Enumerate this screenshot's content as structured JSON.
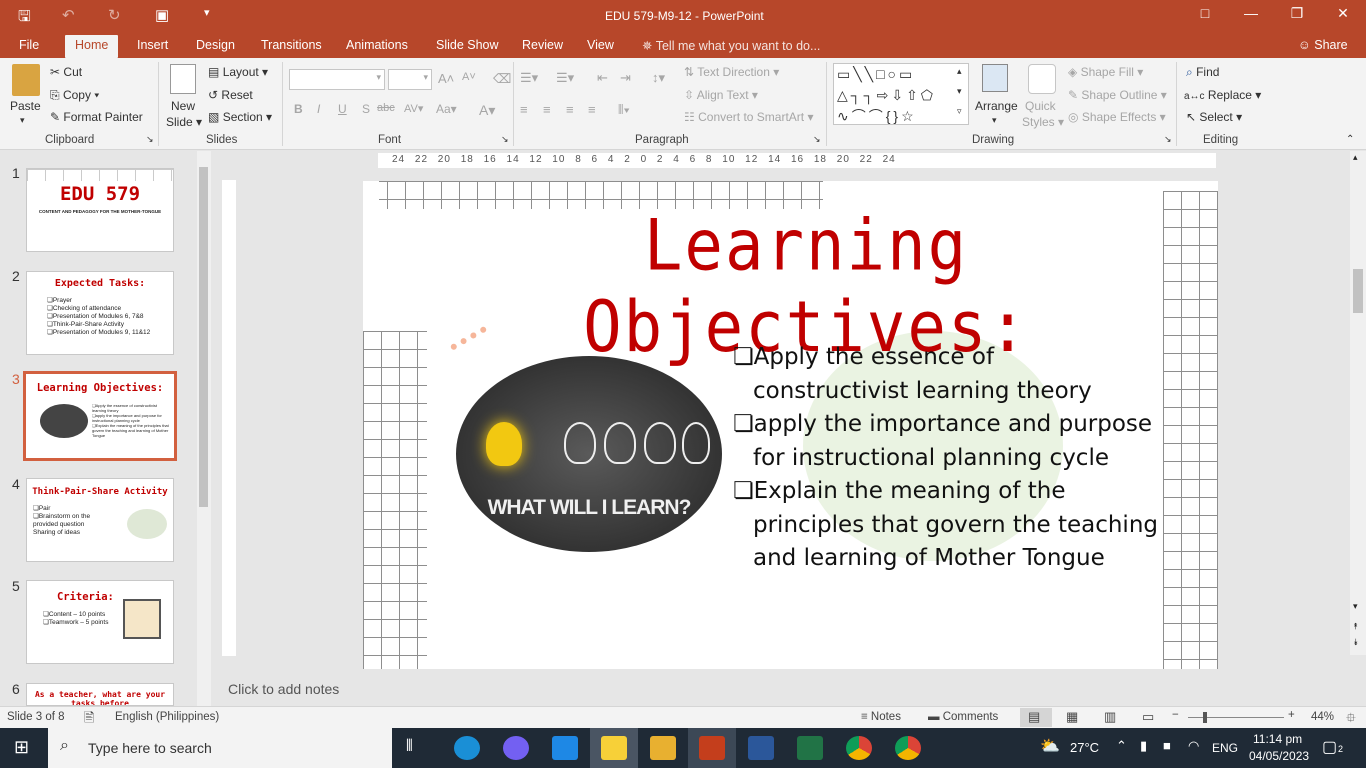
{
  "window": {
    "title": "EDU 579-M9-12 - PowerPoint",
    "share_label": "Share"
  },
  "tabs": [
    "File",
    "Home",
    "Insert",
    "Design",
    "Transitions",
    "Animations",
    "Slide Show",
    "Review",
    "View"
  ],
  "tell_me": "Tell me what you want to do...",
  "ribbon": {
    "clipboard": {
      "paste": "Paste",
      "cut": "Cut",
      "copy": "Copy",
      "format_painter": "Format Painter",
      "group": "Clipboard"
    },
    "slides": {
      "new_slide_1": "New",
      "new_slide_2": "Slide",
      "layout": "Layout",
      "reset": "Reset",
      "section": "Section",
      "group": "Slides"
    },
    "font": {
      "group": "Font"
    },
    "paragraph": {
      "text_direction": "Text Direction",
      "align_text": "Align Text",
      "convert_smartart": "Convert to SmartArt",
      "group": "Paragraph"
    },
    "drawing": {
      "arrange": "Arrange",
      "quick_styles_1": "Quick",
      "quick_styles_2": "Styles",
      "shape_fill": "Shape Fill",
      "shape_outline": "Shape Outline",
      "shape_effects": "Shape Effects",
      "group": "Drawing"
    },
    "editing": {
      "find": "Find",
      "replace": "Replace",
      "select": "Select",
      "group": "Editing"
    }
  },
  "ruler_text": "24 22 20 18 16 14 12 10 8 6 4 2 0 2 4 6 8 10 12 14 16 18 20 22 24",
  "thumbnails": [
    {
      "num": "1",
      "title": "EDU 579",
      "sub": "CONTENT AND PEDAGOGY FOR THE MOTHER-TONGUE"
    },
    {
      "num": "2",
      "title": "Expected Tasks:",
      "lines": [
        "Prayer",
        "Checking of attendance",
        "Presentation of Modules 6, 7&8",
        "Think-Pair-Share Activity",
        "Presentation of Modules 9, 11&12"
      ]
    },
    {
      "num": "3",
      "title": "Learning Objectives:",
      "lines": [
        "Apply the essence of constructivist learning theory",
        "apply the importance and purpose for instructional planning cycle",
        "Explain the meaning of the principles that govern the teaching and learning of Mother Tongue"
      ]
    },
    {
      "num": "4",
      "title": "Think-Pair-Share Activity",
      "lines": [
        "Pair",
        "Brainstorm on the provided question",
        "Sharing of ideas"
      ]
    },
    {
      "num": "5",
      "title": "Criteria:",
      "lines": [
        "Content – 10 points",
        "Teamwork – 5 points"
      ]
    },
    {
      "num": "6",
      "title": "As a teacher, what are your tasks before"
    }
  ],
  "slide": {
    "title": "Learning Objectives:",
    "image_text": "WHAT WILL I LEARN?",
    "bullets": [
      [
        "Apply the essence of",
        "constructivist learning theory"
      ],
      [
        "apply the importance and purpose",
        "for instructional planning cycle"
      ],
      [
        "Explain the meaning of the",
        "principles that govern the teaching",
        "and learning of Mother Tongue"
      ]
    ]
  },
  "notes_placeholder": "Click to add notes",
  "status": {
    "slide_of": "Slide 3 of 8",
    "language": "English (Philippines)",
    "notes": "Notes",
    "comments": "Comments",
    "zoom": "44%"
  },
  "taskbar": {
    "search_placeholder": "Type here to search",
    "weather": "27°C",
    "lang": "ENG",
    "time": "11:14 pm",
    "date": "04/05/2023",
    "notif_count": "2"
  }
}
